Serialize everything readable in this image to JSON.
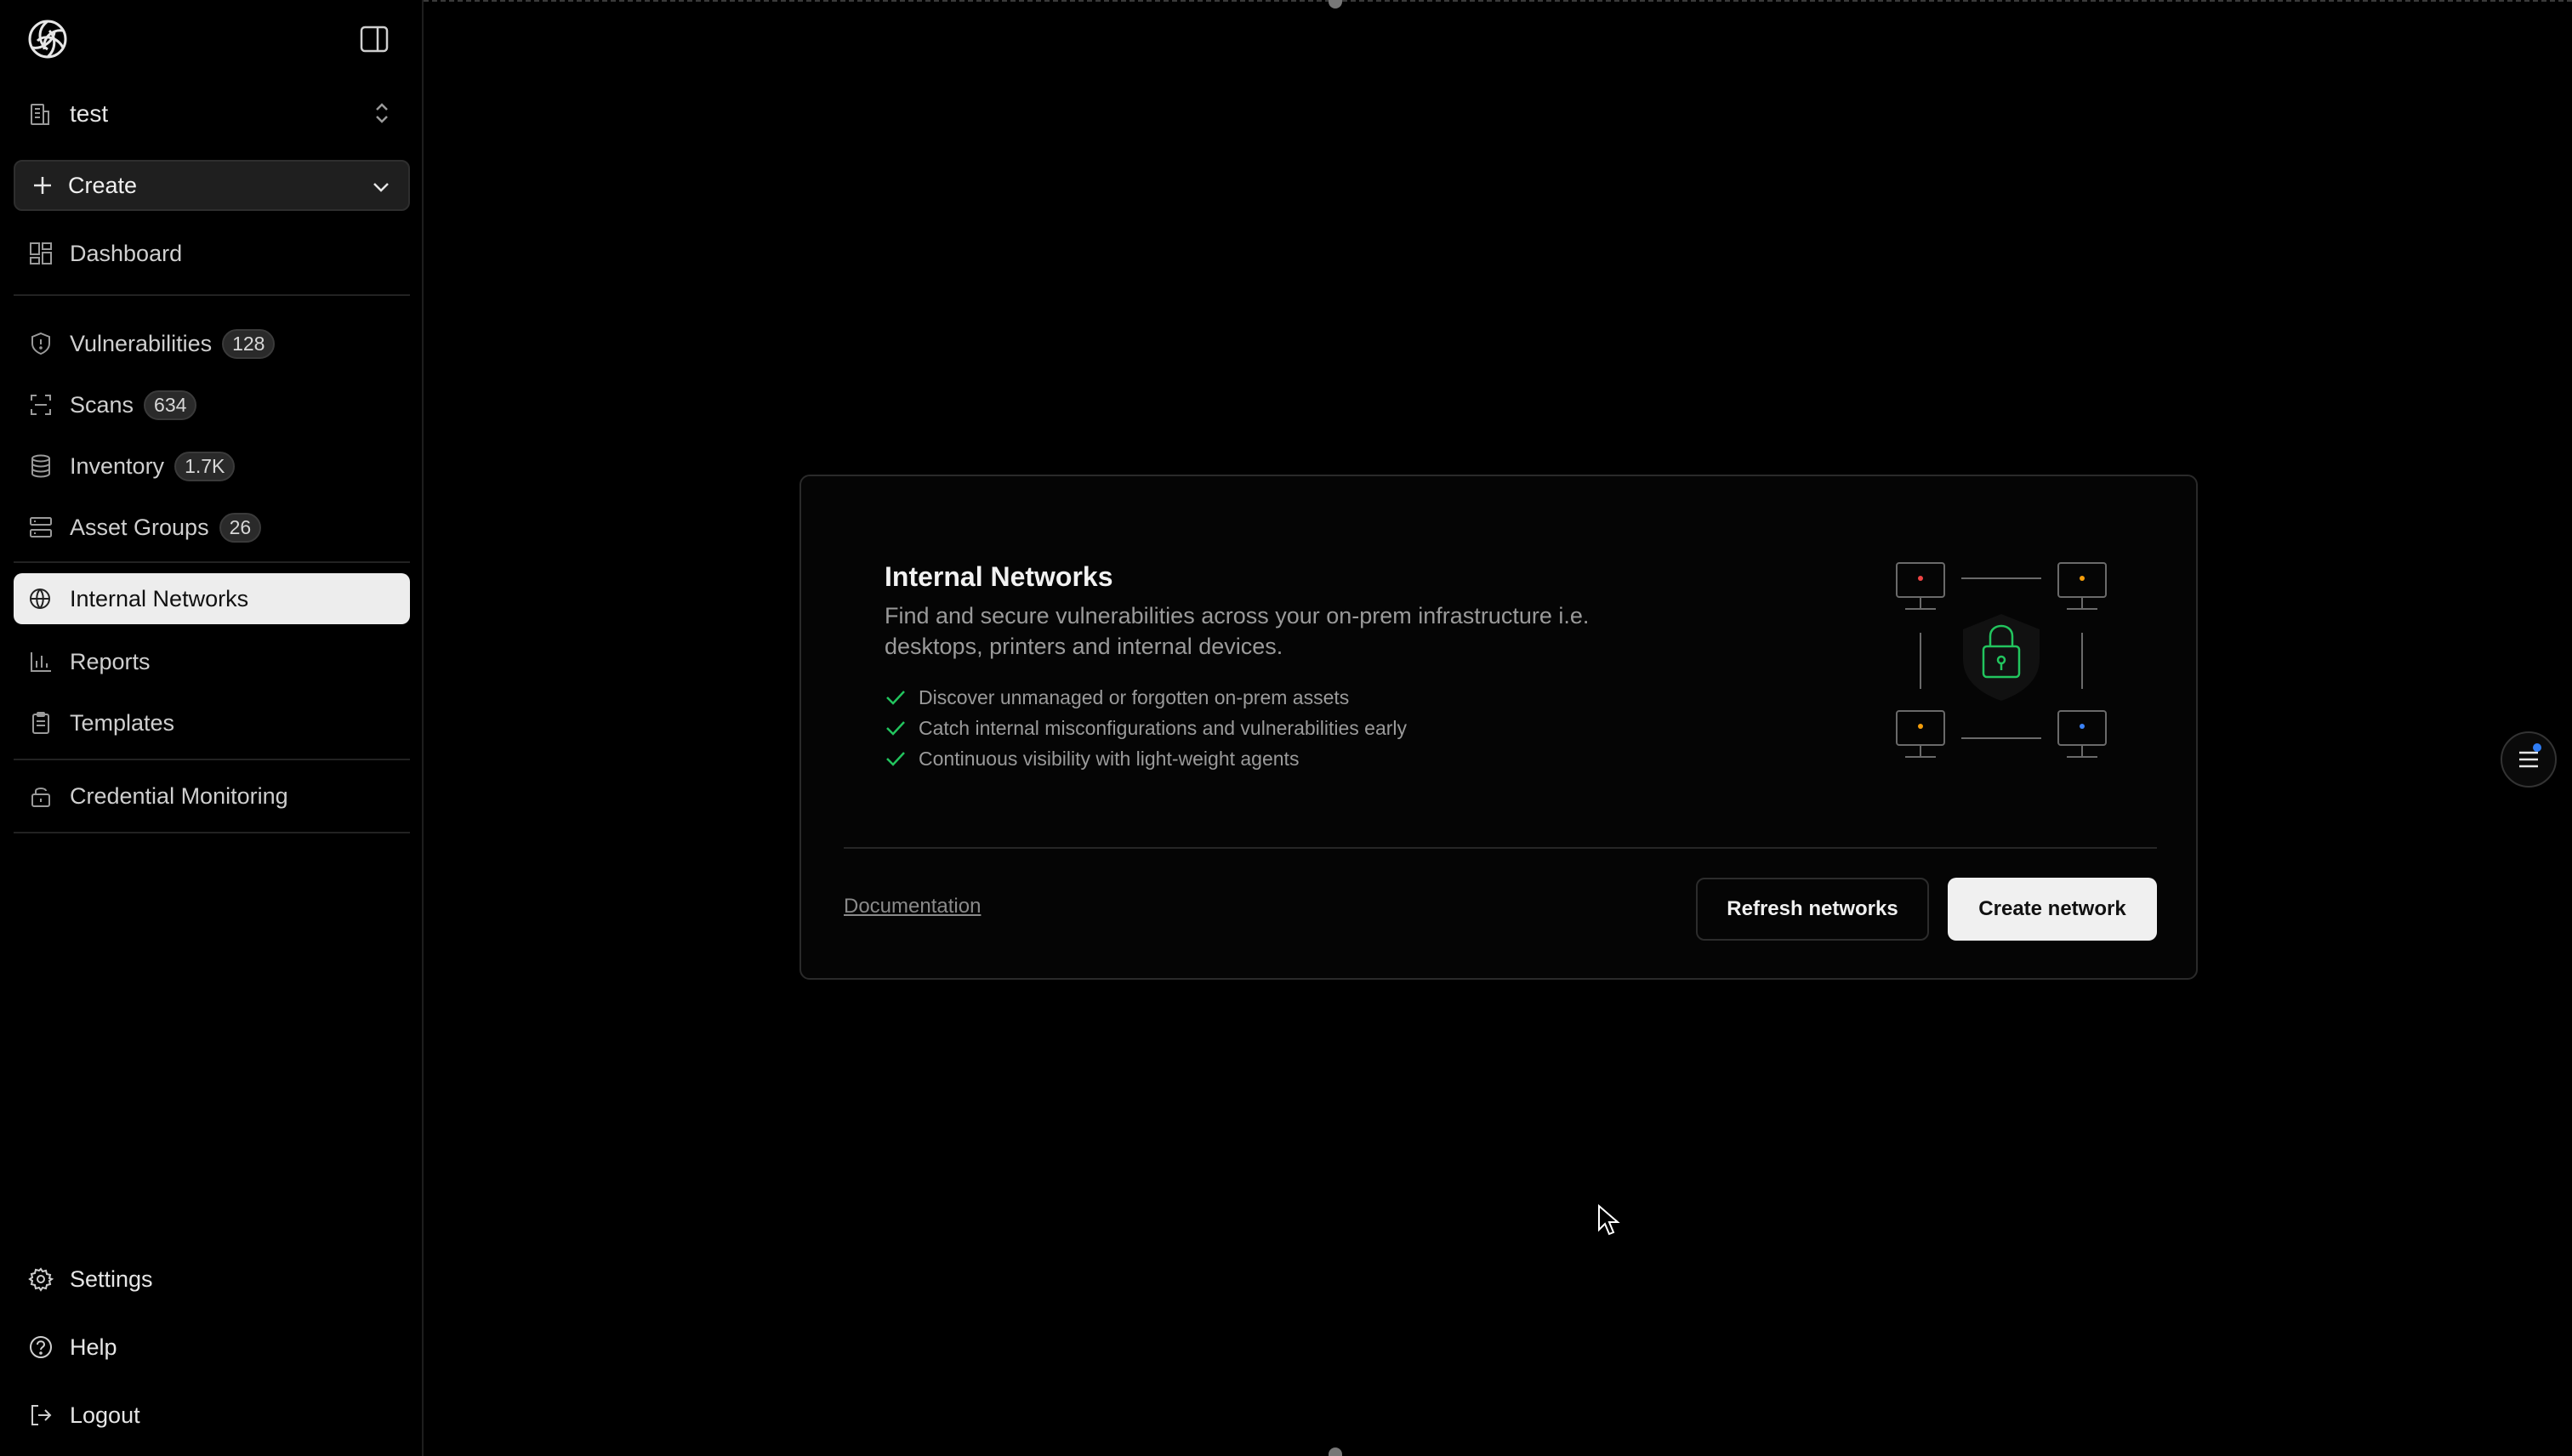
{
  "workspace": {
    "name": "test"
  },
  "create": {
    "label": "Create"
  },
  "nav": {
    "dashboard": "Dashboard",
    "vulnerabilities": {
      "label": "Vulnerabilities",
      "count": "128"
    },
    "scans": {
      "label": "Scans",
      "count": "634"
    },
    "inventory": {
      "label": "Inventory",
      "count": "1.7K"
    },
    "asset_groups": {
      "label": "Asset Groups",
      "count": "26"
    },
    "internal_networks": "Internal Networks",
    "reports": "Reports",
    "templates": "Templates",
    "credential_monitoring": "Credential Monitoring",
    "settings": "Settings",
    "help": "Help",
    "logout": "Logout"
  },
  "card": {
    "title": "Internal Networks",
    "description": "Find and secure vulnerabilities across your on-prem infrastructure i.e. desktops, printers and internal devices.",
    "features": [
      "Discover unmanaged or forgotten on-prem assets",
      "Catch internal misconfigurations and vulnerabilities early",
      "Continuous visibility with light-weight agents"
    ],
    "documentation_link": "Documentation",
    "refresh_button": "Refresh networks",
    "create_button": "Create network"
  },
  "colors": {
    "accent_green": "#22c55e",
    "active_nav_bg": "#ededed",
    "notification_dot": "#2f7df6"
  }
}
